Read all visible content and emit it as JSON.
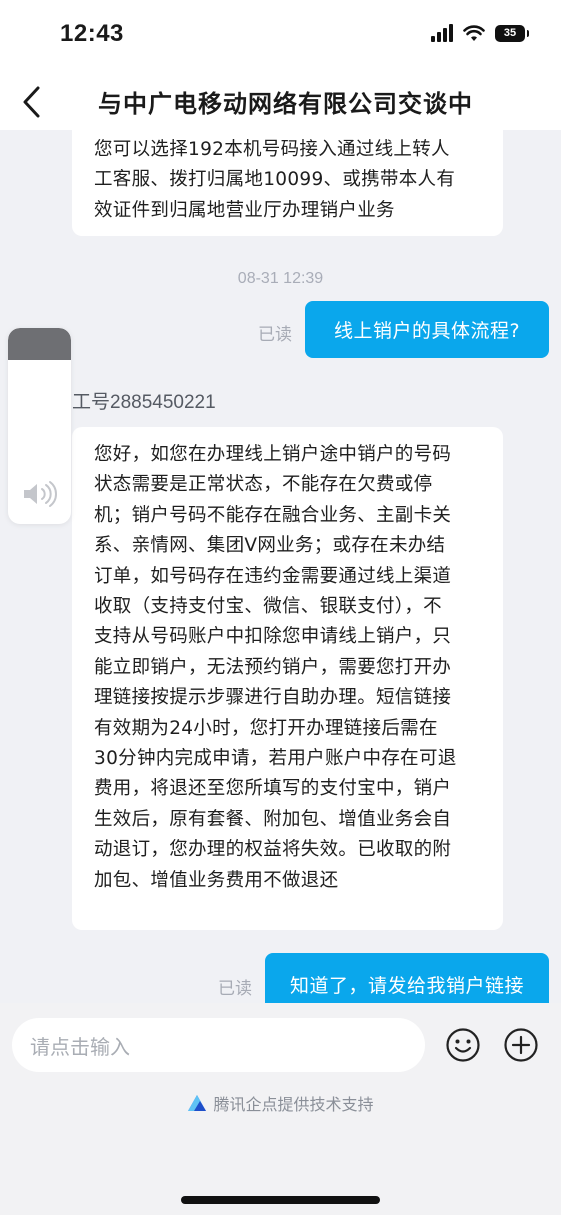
{
  "status": {
    "time": "12:43",
    "battery": "35"
  },
  "header": {
    "title": "与中广电移动网络有限公司交谈中"
  },
  "messages": {
    "agent_top": [
      "您可以选择192本机号码接入通过线上转人",
      "工客服、拨打归属地10099、或携带本人有",
      "效证件到归属地营业厅办理销户业务"
    ],
    "timestamp": "08-31 12:39",
    "read_label": "已读",
    "user_question": "线上销户的具体流程?",
    "agent_name": "工号2885450221",
    "agent_reply": [
      "您好，如您在办理线上销户途中销户的号码",
      "状态需要是正常状态，不能存在欠费或停",
      "机；销户号码不能存在融合业务、主副卡关",
      "系、亲情网、集团V网业务；或存在未办结",
      "订单，如号码存在违约金需要通过线上渠道",
      "收取（支持支付宝、微信、银联支付），不",
      "支持从号码账户中扣除您申请线上销户，只",
      "能立即销户，无法预约销户，需要您打开办",
      "理链接按提示步骤进行自助办理。短信链接",
      "有效期为24小时，您打开办理链接后需在",
      "30分钟内完成申请，若用户账户中存在可退",
      "费用，将退还至您所填写的支付宝中，销户",
      "生效后，原有套餐、附加包、增值业务会自",
      "动退订，您办理的权益将失效。已收取的附",
      "加包、增值业务费用不做退还"
    ],
    "user_followup": "知道了，请发给我销户链接"
  },
  "input": {
    "placeholder": "请点击输入"
  },
  "footer": {
    "powered_by": "腾讯企点提供技术支持"
  },
  "colors": {
    "accent": "#0aa7ec",
    "background": "#f0f1f5"
  },
  "icons": [
    "back-arrow-icon",
    "signal-icon",
    "wifi-icon",
    "battery-icon",
    "speaker-icon",
    "emoji-icon",
    "plus-icon",
    "tencent-qidian-logo-icon"
  ]
}
